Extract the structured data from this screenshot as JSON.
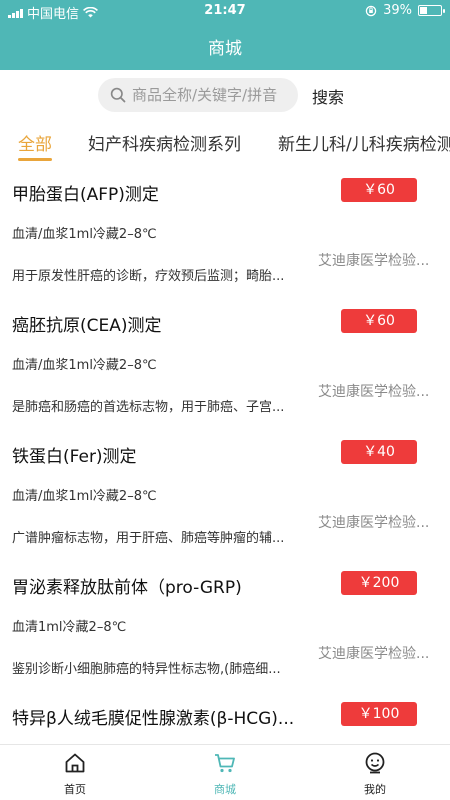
{
  "status_bar": {
    "carrier": "中国电信",
    "time": "21:47",
    "battery": "39%",
    "battery_level": 0.39
  },
  "header": {
    "title": "商城"
  },
  "search": {
    "placeholder": "商品全称/关键字/拼音",
    "button_label": "搜索"
  },
  "tabs": [
    {
      "label": "全部",
      "active": true
    },
    {
      "label": "妇产科疾病检测系列",
      "active": false
    },
    {
      "label": "新生儿科/儿科疾病检测",
      "active": false
    }
  ],
  "products": [
    {
      "name": "甲胎蛋白(AFP)测定",
      "price": "￥60",
      "spec": "血清/血浆1ml冷藏2–8℃",
      "vendor": "艾迪康医学检验...",
      "description": "用于原发性肝癌的诊断，疗效预后监测；畸胎..."
    },
    {
      "name": "癌胚抗原(CEA)测定",
      "price": "￥60",
      "spec": "血清/血浆1ml冷藏2–8℃",
      "vendor": "艾迪康医学检验...",
      "description": "是肺癌和肠癌的首选标志物，用于肺癌、子宫..."
    },
    {
      "name": "铁蛋白(Fer)测定",
      "price": "￥40",
      "spec": "血清/血浆1ml冷藏2–8℃",
      "vendor": "艾迪康医学检验...",
      "description": "广谱肿瘤标志物，用于肝癌、肺癌等肿瘤的辅..."
    },
    {
      "name": "胃泌素释放肽前体（pro-GRP)",
      "price": "￥200",
      "spec": "血清1ml冷藏2–8℃",
      "vendor": "艾迪康医学检验...",
      "description": "鉴别诊断小细胞肺癌的特异性标志物,(肺癌细..."
    },
    {
      "name": "特异β人绒毛膜促性腺激素(β-HCG)...",
      "price": "￥100",
      "spec": "",
      "vendor": "",
      "description": ""
    }
  ],
  "bottom_nav": [
    {
      "label": "首页",
      "icon": "home-icon",
      "active": false
    },
    {
      "label": "商城",
      "icon": "cart-icon",
      "active": true
    },
    {
      "label": "我的",
      "icon": "profile-icon",
      "active": false
    }
  ],
  "colors": {
    "header_bg": "#4FB7B6",
    "accent": "#E9A53B",
    "price_badge": "#EE3B3B"
  }
}
